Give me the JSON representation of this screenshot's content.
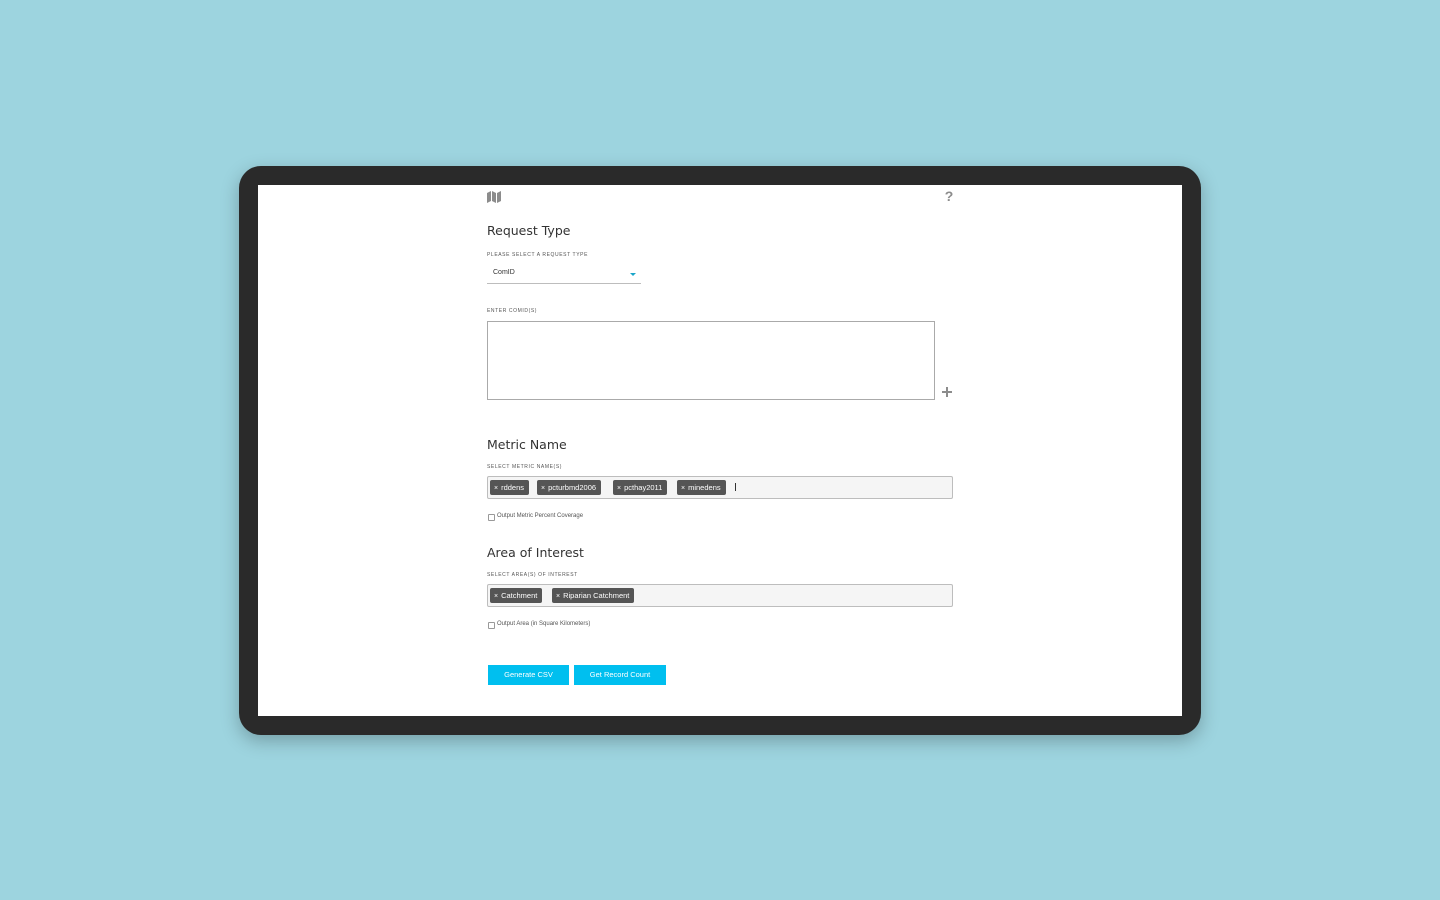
{
  "header": {
    "map_icon": "map-icon",
    "help_icon": "help-icon",
    "help_glyph": "?"
  },
  "request_type": {
    "title": "Request Type",
    "select_label": "PLEASE SELECT A REQUEST TYPE",
    "selected_value": "ComID",
    "input_label": "ENTER COMID(S)",
    "input_value": "",
    "add_icon": "plus-icon"
  },
  "metric_name": {
    "title": "Metric Name",
    "select_label": "SELECT METRIC NAME(S)",
    "tags": [
      "rddens",
      "pcturbmd2006",
      "pcthay2011",
      "minedens"
    ],
    "checkbox_label": "Output Metric Percent Coverage",
    "checkbox_checked": false
  },
  "area_of_interest": {
    "title": "Area of Interest",
    "select_label": "SELECT AREA(S) OF INTEREST",
    "tags": [
      "Catchment",
      "Riparian Catchment"
    ],
    "checkbox_label": "Output Area (in Square Kilometers)",
    "checkbox_checked": false
  },
  "actions": {
    "generate_label": "Generate CSV",
    "count_label": "Get Record Count"
  },
  "colors": {
    "accent": "#00bfef",
    "tag_bg": "#555555",
    "background": "#9dd4df",
    "device_frame": "#2a2a2a"
  }
}
